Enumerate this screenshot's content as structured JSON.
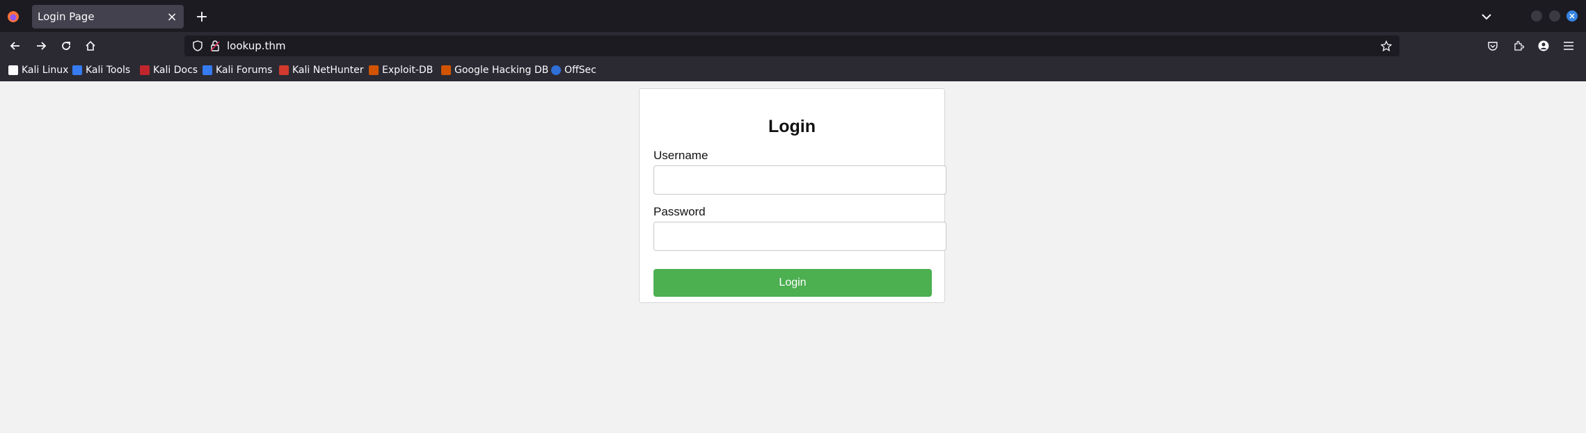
{
  "browser": {
    "tab": {
      "title": "Login Page"
    },
    "url": "lookup.thm",
    "bookmarks": [
      {
        "label": "Kali Linux",
        "color": "#111111"
      },
      {
        "label": "Kali Tools",
        "color": "#367bf0"
      },
      {
        "label": "Kali Docs",
        "color": "#c0262b"
      },
      {
        "label": "Kali Forums",
        "color": "#367bf0"
      },
      {
        "label": "Kali NetHunter",
        "color": "#d13a2c"
      },
      {
        "label": "Exploit-DB",
        "color": "#d35400"
      },
      {
        "label": "Google Hacking DB",
        "color": "#d35400"
      },
      {
        "label": "OffSec",
        "color": "#2f6fd6"
      }
    ]
  },
  "login": {
    "title": "Login",
    "username_label": "Username",
    "username_value": "",
    "password_label": "Password",
    "password_value": "",
    "button_label": "Login",
    "button_color": "#4caf50"
  }
}
